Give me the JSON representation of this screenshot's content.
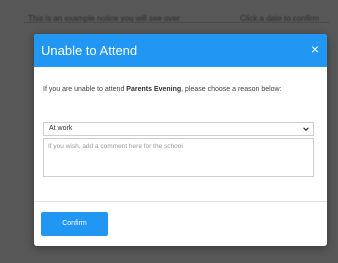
{
  "backdrop": {
    "left_text": "This is an example notice you will see over",
    "right_text": "Click a date to confirm"
  },
  "dialog": {
    "title": "Unable to Attend",
    "close_glyph": "×",
    "intro_before": "If you are unable to attend ",
    "event_name": "Parents Evening",
    "intro_after": ", please choose a reason below:",
    "reason_select": {
      "selected": "At work"
    },
    "comment": {
      "placeholder": "If you wish, add a comment here for the school",
      "value": ""
    },
    "confirm_label": "Confirm"
  },
  "colors": {
    "accent": "#2196f3",
    "overlay": "#575757"
  }
}
